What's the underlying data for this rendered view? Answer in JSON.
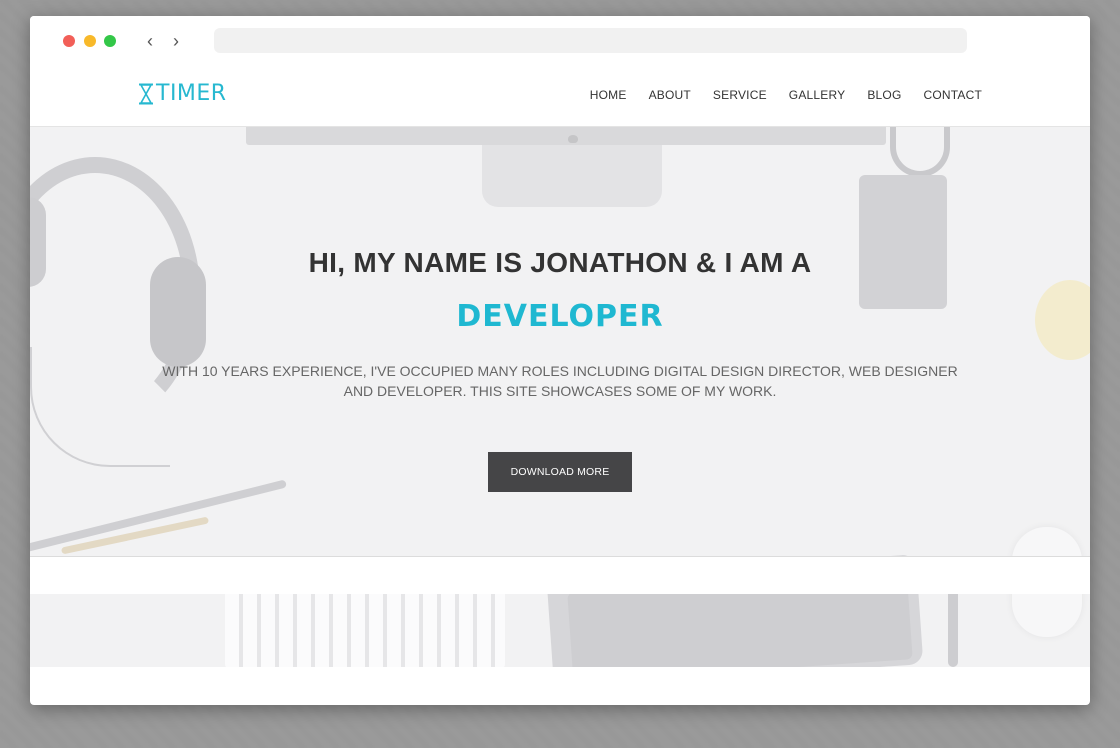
{
  "browser": {
    "back_icon": "‹",
    "forward_icon": "›",
    "address": ""
  },
  "site": {
    "logo_text": "TIMER",
    "logo_icon": "hourglass-icon",
    "brand_color": "#27b8d0",
    "menu": [
      "HOME",
      "ABOUT",
      "SERVICE",
      "GALLERY",
      "BLOG",
      "CONTACT"
    ]
  },
  "hero": {
    "title": "HI, MY NAME IS JONATHON & I AM A",
    "role": "DEVELOPER",
    "description": "WITH 10 YEARS EXPERIENCE, I'VE OCCUPIED MANY ROLES INCLUDING DIGITAL DESIGN DIRECTOR, WEB DESIGNER AND DEVELOPER. THIS SITE SHOWCASES SOME OF MY WORK.",
    "cta_label": "DOWNLOAD MORE",
    "accent_color": "#1fb8d1",
    "button_color": "#454547"
  }
}
